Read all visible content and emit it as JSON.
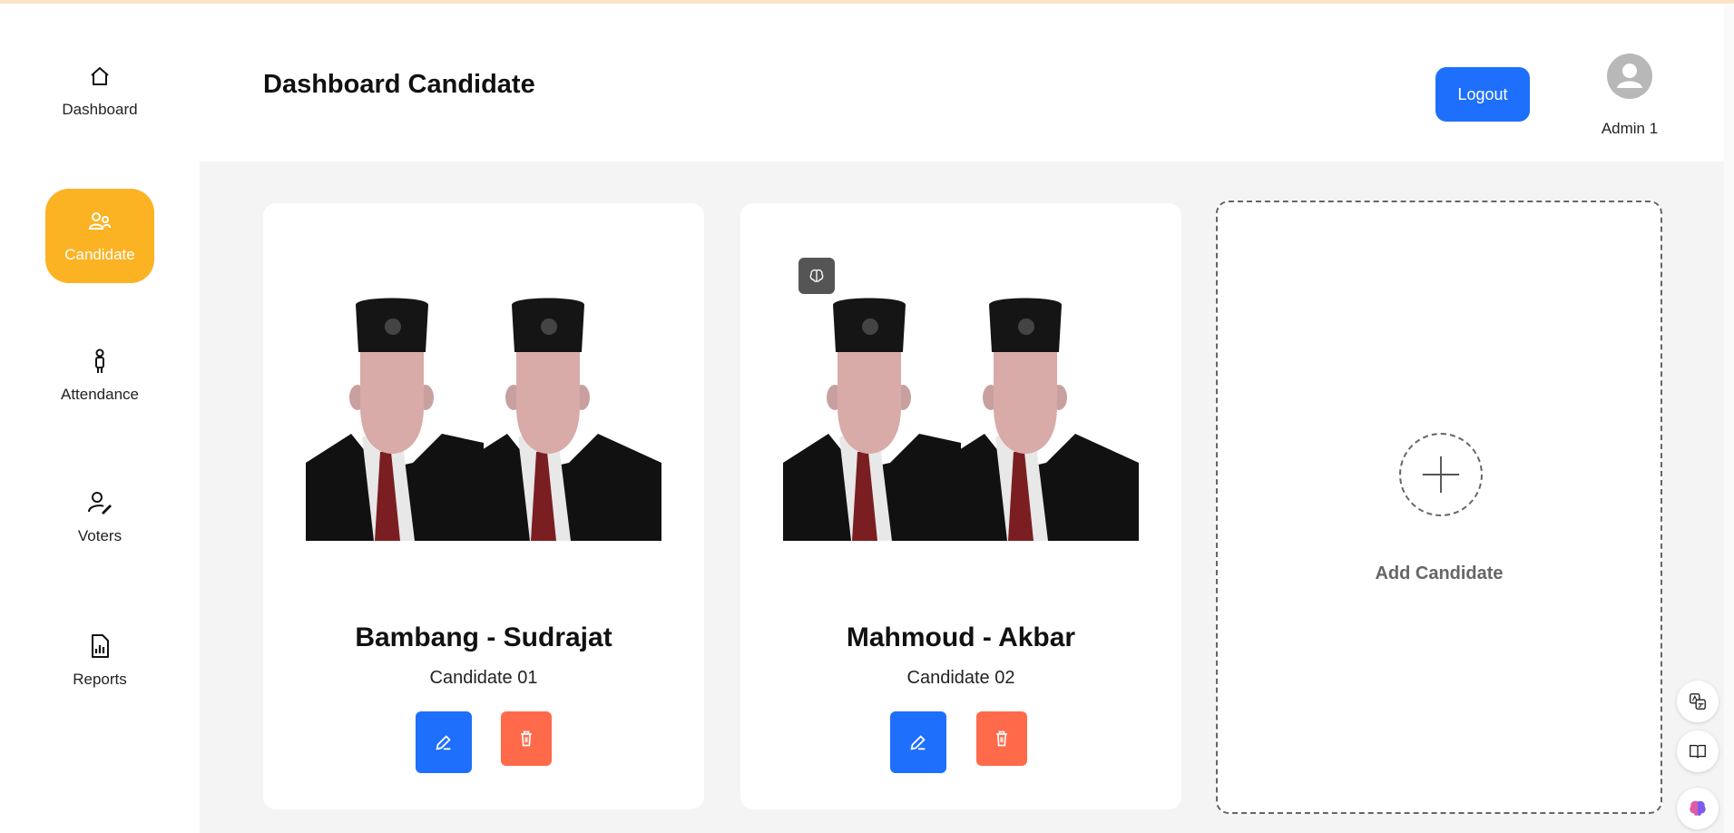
{
  "sidebar": {
    "items": [
      {
        "label": "Dashboard",
        "icon": "home-icon",
        "active": false
      },
      {
        "label": "Candidate",
        "icon": "users-icon",
        "active": true
      },
      {
        "label": "Attendance",
        "icon": "person-icon",
        "active": false
      },
      {
        "label": "Voters",
        "icon": "user-edit-icon",
        "active": false
      },
      {
        "label": "Reports",
        "icon": "report-icon",
        "active": false
      }
    ]
  },
  "header": {
    "title": "Dashboard Candidate",
    "logout_label": "Logout",
    "user_name": "Admin 1"
  },
  "candidates": [
    {
      "name": "Bambang - Sudrajat",
      "number": "Candidate 01"
    },
    {
      "name": "Mahmoud - Akbar",
      "number": "Candidate 02"
    }
  ],
  "add_card": {
    "label": "Add Candidate"
  },
  "colors": {
    "accent": "#fbb324",
    "primary": "#1e6ffb",
    "danger": "#ff6a4b"
  }
}
